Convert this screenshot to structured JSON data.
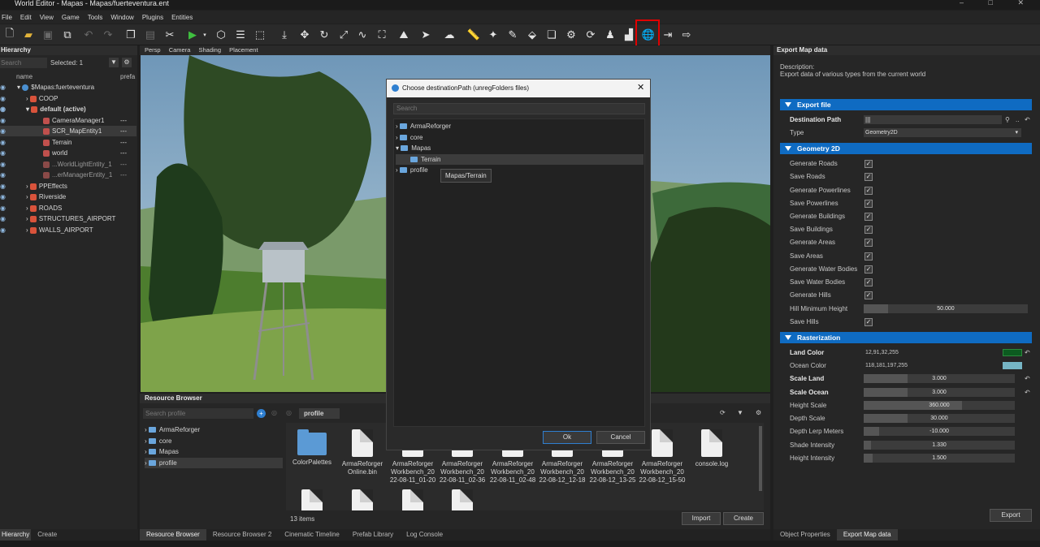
{
  "window": {
    "title": "World Editor - Mapas - Mapas/fuerteventura.ent",
    "controls": "–  □  ✕"
  },
  "menu": [
    "File",
    "Edit",
    "View",
    "Game",
    "Tools",
    "Window",
    "Plugins",
    "Entities"
  ],
  "hierarchy": {
    "title": "Hierarchy",
    "search_placeholder": "Search",
    "selected": "Selected: 1",
    "col_name": "name",
    "col_prefab": "prefa",
    "rows": [
      {
        "label": "$Mapas:fuerteventura"
      },
      {
        "label": "COOP"
      },
      {
        "label": "default (active)"
      },
      {
        "label": "CameraManager1"
      },
      {
        "label": "SCR_MapEntity1",
        "extra": "---"
      },
      {
        "label": "Terrain",
        "extra": "---"
      },
      {
        "label": "world",
        "extra": "---"
      },
      {
        "label": "...WorldLightEntity_1",
        "extra": "---"
      },
      {
        "label": "...erManagerEntity_1",
        "extra": "---"
      },
      {
        "label": "PPEffects"
      },
      {
        "label": "Riverside"
      },
      {
        "label": "ROADS"
      },
      {
        "label": "STRUCTURES_AIRPORT"
      },
      {
        "label": "WALLS_AIRPORT"
      }
    ],
    "camera_extra": "---"
  },
  "viewport_tabs": [
    "Persp",
    "Camera",
    "Shading",
    "Placement"
  ],
  "dialog": {
    "title": "Choose destinationPath (unregFolders files)",
    "search_placeholder": "Search",
    "tree": [
      "ArmaReforger",
      "core",
      "Mapas",
      "Terrain",
      "profile"
    ],
    "tooltip": "Mapas/Terrain",
    "ok": "Ok",
    "cancel": "Cancel"
  },
  "resource_browser": {
    "title": "Resource Browser",
    "search_placeholder": "Search profile",
    "path": "profile",
    "tree": [
      "ArmaReforger",
      "core",
      "Mapas",
      "profile"
    ],
    "files": [
      {
        "name": "ColorPalettes"
      },
      {
        "name": "ArmaReforger Online.bin"
      },
      {
        "name": "ArmaReforger Workbench_20 22-08-11_01-20"
      },
      {
        "name": "ArmaReforger Workbench_20 22-08-11_02-36"
      },
      {
        "name": "ArmaReforger Workbench_20 22-08-11_02-48"
      },
      {
        "name": "ArmaReforger Workbench_20 22-08-12_12-18"
      },
      {
        "name": "ArmaReforger Workbench_20 22-08-12_13-25"
      },
      {
        "name": "ArmaReforger Workbench_20 22-08-12_15-50"
      },
      {
        "name": "console.log"
      }
    ],
    "count": "13 items",
    "import": "Import",
    "create": "Create"
  },
  "bottom_tabs_left": [
    "Hierarchy",
    "Create"
  ],
  "bottom_tabs_center": [
    "Resource Browser",
    "Resource Browser 2",
    "Cinematic Timeline",
    "Prefab Library",
    "Log Console"
  ],
  "bottom_tabs_right": [
    "Object Properties",
    "Export Map data"
  ],
  "export": {
    "title": "Export Map data",
    "desc_label": "Description:",
    "desc": "Export data of various types from the current world",
    "section_file": "Export file",
    "dest_label": "Destination Path",
    "dest_value": "|||",
    "type_label": "Type",
    "type_value": "Geometry2D",
    "section_geo": "Geometry 2D",
    "checks": [
      "Generate Roads",
      "Save Roads",
      "Generate Powerlines",
      "Save Powerlines",
      "Generate Buildings",
      "Save Buildings",
      "Generate Areas",
      "Save Areas",
      "Generate Water Bodies",
      "Save Water Bodies",
      "Generate Hills"
    ],
    "hill_label": "Hill Minimum Height",
    "hill_value": "50.000",
    "save_hills": "Save Hills",
    "section_raster": "Rasterization",
    "land_label": "Land Color",
    "land_value": "12,91,32,255",
    "ocean_label": "Ocean Color",
    "ocean_value": "118,181,197,255",
    "sliders": [
      {
        "label": "Scale Land",
        "value": "3.000",
        "fill": 0.29,
        "bold": true
      },
      {
        "label": "Scale Ocean",
        "value": "3.000",
        "fill": 0.29,
        "bold": true
      },
      {
        "label": "Height Scale",
        "value": "360.000",
        "fill": 0.65,
        "bold": false
      },
      {
        "label": "Depth Scale",
        "value": "30.000",
        "fill": 0.29,
        "bold": false
      },
      {
        "label": "Depth Lerp Meters",
        "value": "-10.000",
        "fill": 0.1,
        "bold": false
      },
      {
        "label": "Shade Intensity",
        "value": "1.330",
        "fill": 0.05,
        "bold": false
      },
      {
        "label": "Height Intensity",
        "value": "1.500",
        "fill": 0.06,
        "bold": false
      }
    ],
    "export_button": "Export"
  },
  "colors": {
    "accent": "#0f6bc2",
    "land": "#0c5b20",
    "ocean": "#76b5c5",
    "highlight": "#e00000"
  }
}
